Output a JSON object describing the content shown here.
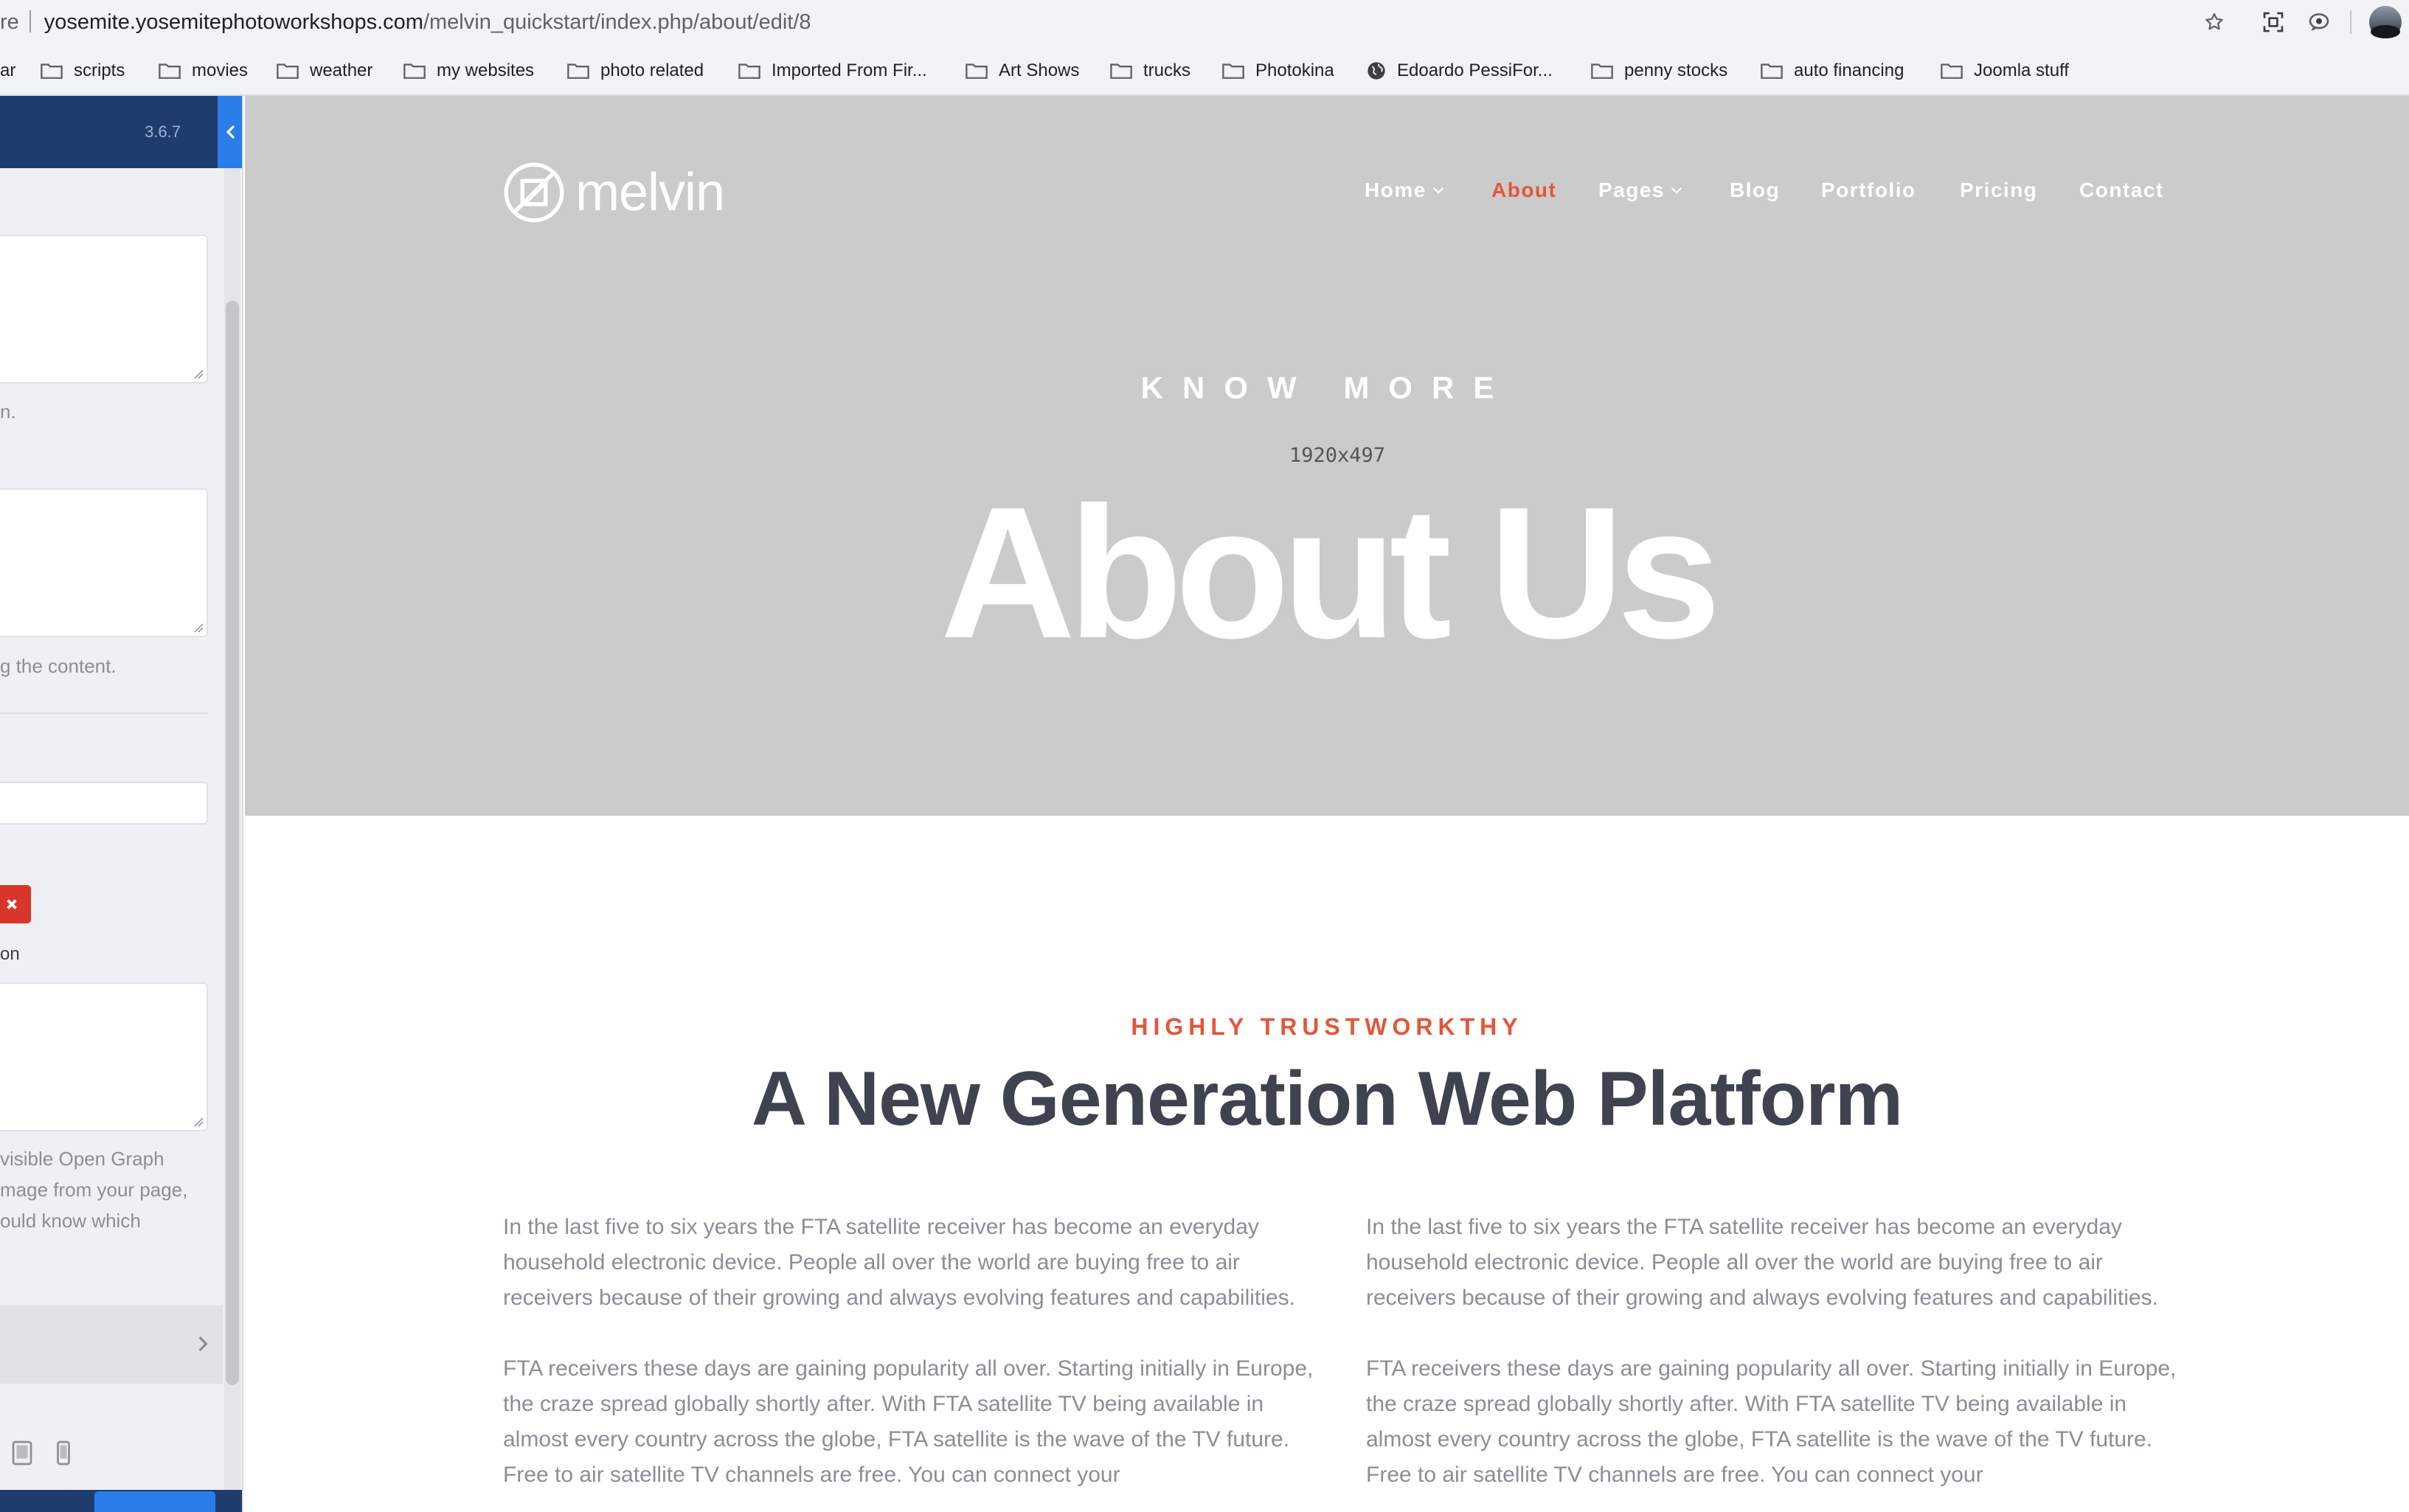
{
  "browser": {
    "address_prefix": "re",
    "address_host": "yosemite.yosemitephotoworkshops.com",
    "address_path": "/melvin_quickstart/index.php/about/edit/8",
    "bookmarks": [
      {
        "label": "ar",
        "icon": "none"
      },
      {
        "label": "scripts",
        "icon": "folder-icon"
      },
      {
        "label": "movies",
        "icon": "folder-icon"
      },
      {
        "label": "weather",
        "icon": "folder-icon"
      },
      {
        "label": "my websites",
        "icon": "folder-icon"
      },
      {
        "label": "photo related",
        "icon": "folder-icon"
      },
      {
        "label": "Imported From Fir...",
        "icon": "folder-icon"
      },
      {
        "label": "Art Shows",
        "icon": "folder-icon"
      },
      {
        "label": "trucks",
        "icon": "folder-icon"
      },
      {
        "label": "Photokina",
        "icon": "folder-icon"
      },
      {
        "label": "Edoardo PessiFor...",
        "icon": "globe-icon"
      },
      {
        "label": "penny stocks",
        "icon": "folder-icon"
      },
      {
        "label": "auto financing",
        "icon": "folder-icon"
      },
      {
        "label": "Joomla stuff",
        "icon": "folder-icon"
      }
    ]
  },
  "panel": {
    "version": "3.6.7",
    "help_1": "n.",
    "help_2": "g the content.",
    "field_label": "on",
    "og_help_lines": [
      "visible Open Graph",
      "mage from your page,",
      "ould know which"
    ]
  },
  "site": {
    "logo_text": "melvin",
    "nav": [
      {
        "label": "Home",
        "dropdown": true,
        "active": false
      },
      {
        "label": "About",
        "dropdown": false,
        "active": true
      },
      {
        "label": "Pages",
        "dropdown": true,
        "active": false
      },
      {
        "label": "Blog",
        "dropdown": false,
        "active": false
      },
      {
        "label": "Portfolio",
        "dropdown": false,
        "active": false
      },
      {
        "label": "Pricing",
        "dropdown": false,
        "active": false
      },
      {
        "label": "Contact",
        "dropdown": false,
        "active": false
      }
    ],
    "hero_kicker": "KNOW MORE",
    "hero_placeholder_size": "1920x497",
    "hero_title": "About Us",
    "section_kicker": "HIGHLY TRUSTWORKTHY",
    "section_title": "A New Generation Web Platform",
    "col_left": {
      "p1": "In the last five to six years the FTA satellite receiver has become an everyday household electronic device. People all over the world are buying free to air receivers because of their growing and always evolving features and capabilities.",
      "p2": "FTA receivers these days are gaining popularity all over. Starting initially in Europe, the craze spread globally shortly after. With FTA satellite TV being available in almost every country across the globe, FTA satellite is the wave of the TV future. Free to air satellite TV channels are free. You can connect your"
    },
    "col_right": {
      "p1": "In the last five to six years the FTA satellite receiver has become an everyday household electronic device. People all over the world are buying free to air receivers because of their growing and always evolving features and capabilities.",
      "p2": "FTA receivers these days are gaining popularity all over. Starting initially in Europe, the craze spread globally shortly after. With FTA satellite TV being available in almost every country across the globe, FTA satellite is the wave of the TV future. Free to air satellite TV channels are free. You can connect your"
    }
  },
  "colors": {
    "accent": "#e2573a",
    "hero_bg": "#cbcbcb",
    "heading": "#3f4350",
    "body_text": "#8a8e96",
    "panel_header": "#1e3d6e",
    "panel_blue": "#2b7de9",
    "danger": "#d9362b"
  }
}
